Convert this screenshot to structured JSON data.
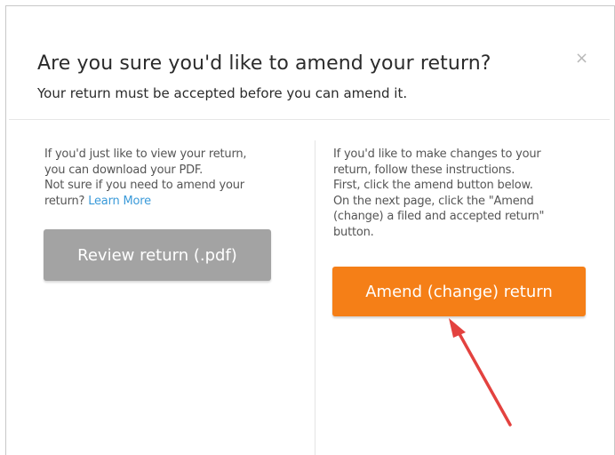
{
  "dialog": {
    "title": "Are you sure you'd like to amend your return?",
    "subtitle": "Your return must be accepted before you can amend it.",
    "close_glyph": "×",
    "close_icon": "close-icon"
  },
  "left_panel": {
    "lines": [
      "If you'd just like to view your return,",
      "you can download your PDF.",
      "Not sure if you need to amend your"
    ],
    "last_line_prefix": "return? ",
    "link_label": "Learn More",
    "button_label": "Review return (.pdf)"
  },
  "right_panel": {
    "lines": [
      "If you'd like to make changes to your",
      "return, follow these instructions.",
      "First, click the amend button below.",
      "On the next page, click the \"Amend",
      "(change) a filed and accepted return\"",
      "button."
    ],
    "button_label": "Amend (change) return"
  },
  "annotation": {
    "arrow_icon": "red-arrow-icon",
    "arrow_color": "#e3423f"
  },
  "colors": {
    "primary_button": "#f57f17",
    "secondary_button": "#a3a3a3",
    "link": "#3a9ad9"
  }
}
